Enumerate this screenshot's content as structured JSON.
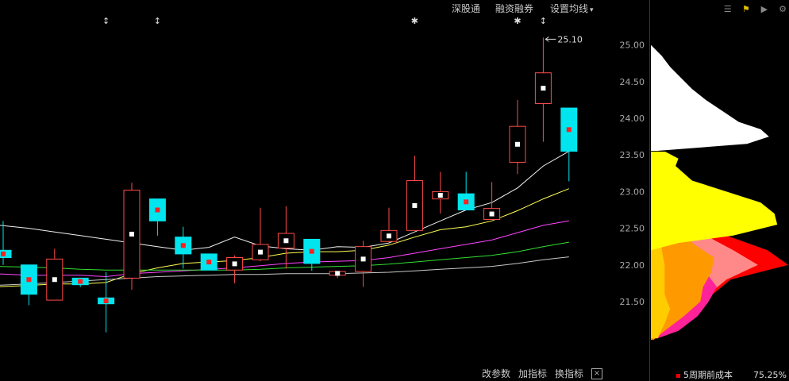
{
  "toolbar": {
    "shen_gu_tong": "深股通",
    "rong_zi_rong_quan": "融资融券",
    "ma_settings": "设置均线",
    "ma_settings_arrow": "▾"
  },
  "bottom": {
    "change_params": "改参数",
    "add_indicator": "加指标",
    "switch_indicator": "换指标",
    "close": "×"
  },
  "chip": {
    "legend_label": "5周期前成本",
    "legend_pct": "75.25%"
  },
  "icons": [
    "list-icon",
    "flag-icon",
    "play-icon",
    "gear-icon"
  ],
  "chart_data": {
    "type": "candlestick",
    "ylim": [
      20.85,
      25.18
    ],
    "yticks": [
      21.5,
      22.0,
      22.5,
      23.0,
      23.5,
      24.0,
      24.5,
      25.0
    ],
    "ytick_labels": [
      "21.50",
      "22.00",
      "22.50",
      "23.00",
      "23.50",
      "24.00",
      "24.50",
      "25.00"
    ],
    "max_label": "25.10",
    "candles": [
      {
        "o": 22.2,
        "c": 22.1,
        "h": 22.6,
        "l": 22.0,
        "mid": "red"
      },
      {
        "o": 22.0,
        "c": 21.6,
        "h": 22.0,
        "l": 21.45,
        "mid": "red"
      },
      {
        "o": 21.52,
        "c": 22.08,
        "h": 22.22,
        "l": 21.52,
        "mid": "white"
      },
      {
        "o": 21.82,
        "c": 21.73,
        "h": 21.82,
        "l": 21.7,
        "mid": "red"
      },
      {
        "o": 21.55,
        "c": 21.47,
        "h": 21.9,
        "l": 21.08,
        "mid": "red"
      },
      {
        "o": 21.82,
        "c": 23.02,
        "h": 23.12,
        "l": 21.66,
        "mid": "white"
      },
      {
        "o": 22.9,
        "c": 22.6,
        "h": 22.9,
        "l": 22.4,
        "mid": "red"
      },
      {
        "o": 22.38,
        "c": 22.15,
        "h": 22.52,
        "l": 21.95,
        "mid": "red"
      },
      {
        "o": 22.15,
        "c": 21.93,
        "h": 22.15,
        "l": 21.93,
        "mid": "red"
      },
      {
        "o": 21.93,
        "c": 22.1,
        "h": 22.13,
        "l": 21.75,
        "mid": "white"
      },
      {
        "o": 22.07,
        "c": 22.28,
        "h": 22.78,
        "l": 22.05,
        "mid": "white"
      },
      {
        "o": 22.23,
        "c": 22.43,
        "h": 22.8,
        "l": 21.95,
        "mid": "white"
      },
      {
        "o": 22.35,
        "c": 22.02,
        "h": 22.35,
        "l": 21.92,
        "mid": "red"
      },
      {
        "o": 21.86,
        "c": 21.91,
        "h": 21.91,
        "l": 21.82,
        "mid": "white"
      },
      {
        "o": 21.91,
        "c": 22.25,
        "h": 22.33,
        "l": 21.7,
        "mid": "white"
      },
      {
        "o": 22.32,
        "c": 22.47,
        "h": 22.78,
        "l": 22.31,
        "mid": "white"
      },
      {
        "o": 22.47,
        "c": 23.15,
        "h": 23.49,
        "l": 22.47,
        "mid": "white"
      },
      {
        "o": 22.9,
        "c": 23.0,
        "h": 23.27,
        "l": 22.7,
        "mid": "white"
      },
      {
        "o": 22.97,
        "c": 22.75,
        "h": 23.27,
        "l": 22.75,
        "mid": "red"
      },
      {
        "o": 22.62,
        "c": 22.77,
        "h": 23.13,
        "l": 22.62,
        "mid": "white"
      },
      {
        "o": 23.4,
        "c": 23.89,
        "h": 24.25,
        "l": 23.24,
        "mid": "white"
      },
      {
        "o": 24.2,
        "c": 24.62,
        "h": 25.1,
        "l": 23.68,
        "mid": "white"
      },
      {
        "o": 24.14,
        "c": 23.55,
        "h": 24.14,
        "l": 23.14,
        "mid": "red"
      }
    ],
    "markers": [
      {
        "index": 4,
        "symbol": "↕"
      },
      {
        "index": 6,
        "symbol": "↕"
      },
      {
        "index": 16,
        "symbol": "✱"
      },
      {
        "index": 20,
        "symbol": "✱"
      },
      {
        "index": 21,
        "symbol": "↕"
      }
    ],
    "ma_lines": [
      {
        "color": "#f0f0f0",
        "values": [
          22.55,
          22.5,
          22.45,
          22.4,
          22.35,
          22.3,
          22.25,
          22.2,
          22.24,
          22.38,
          22.26,
          22.22,
          22.2,
          22.25,
          22.24,
          22.3,
          22.45,
          22.6,
          22.75,
          22.85,
          23.05,
          23.35,
          23.55
        ]
      },
      {
        "color": "#ffff55",
        "values": [
          21.7,
          21.72,
          21.74,
          21.74,
          21.76,
          21.88,
          21.96,
          22.02,
          22.04,
          22.06,
          22.1,
          22.16,
          22.18,
          22.18,
          22.2,
          22.27,
          22.38,
          22.48,
          22.52,
          22.6,
          22.74,
          22.9,
          23.04
        ]
      },
      {
        "color": "#ff44ff",
        "values": [
          21.88,
          21.86,
          21.86,
          21.86,
          21.84,
          21.88,
          21.9,
          21.92,
          21.94,
          21.96,
          21.99,
          22.02,
          22.04,
          22.05,
          22.06,
          22.1,
          22.16,
          22.22,
          22.28,
          22.34,
          22.44,
          22.54,
          22.6
        ]
      },
      {
        "color": "#33dd33",
        "values": [
          21.98,
          21.97,
          21.96,
          21.94,
          21.93,
          21.93,
          21.93,
          21.93,
          21.93,
          21.93,
          21.94,
          21.96,
          21.97,
          21.98,
          21.99,
          22.01,
          22.04,
          22.07,
          22.1,
          22.13,
          22.18,
          22.25,
          22.31
        ]
      },
      {
        "color": "#c8c8c8",
        "values": [
          21.72,
          21.74,
          21.76,
          21.78,
          21.8,
          21.82,
          21.84,
          21.85,
          21.86,
          21.87,
          21.87,
          21.88,
          21.88,
          21.88,
          21.89,
          21.9,
          21.92,
          21.94,
          21.96,
          21.98,
          22.02,
          22.07,
          22.11
        ]
      }
    ],
    "chip_split_price": 23.55,
    "chip_layers": [
      {
        "name": "5周期前成本",
        "color": "#ff0000",
        "profile": [
          [
            23.4,
            0.0
          ],
          [
            23.2,
            0.02
          ],
          [
            23.0,
            0.1
          ],
          [
            22.8,
            0.28
          ],
          [
            22.6,
            0.4
          ],
          [
            22.4,
            0.55
          ],
          [
            22.2,
            0.85
          ],
          [
            22.0,
            1.0
          ],
          [
            21.8,
            0.58
          ],
          [
            21.6,
            0.45
          ],
          [
            21.4,
            0.38
          ],
          [
            21.2,
            0.22
          ],
          [
            21.0,
            0.05
          ]
        ]
      },
      {
        "color": "#ff8888",
        "profile": [
          [
            23.0,
            0.0
          ],
          [
            22.8,
            0.1
          ],
          [
            22.6,
            0.22
          ],
          [
            22.4,
            0.4
          ],
          [
            22.2,
            0.6
          ],
          [
            22.0,
            0.78
          ],
          [
            21.8,
            0.55
          ],
          [
            21.6,
            0.42
          ],
          [
            21.4,
            0.36
          ],
          [
            21.2,
            0.2
          ],
          [
            21.0,
            0.05
          ]
        ]
      },
      {
        "color": "#ff2299",
        "profile": [
          [
            22.7,
            0.0
          ],
          [
            22.5,
            0.06
          ],
          [
            22.3,
            0.18
          ],
          [
            22.1,
            0.3
          ],
          [
            21.9,
            0.4
          ],
          [
            21.7,
            0.48
          ],
          [
            21.5,
            0.42
          ],
          [
            21.3,
            0.34
          ],
          [
            21.1,
            0.2
          ],
          [
            21.0,
            0.05
          ]
        ]
      },
      {
        "color": "#ff9900",
        "profile": [
          [
            23.3,
            0.0
          ],
          [
            23.1,
            0.05
          ],
          [
            22.9,
            0.14
          ],
          [
            22.7,
            0.24
          ],
          [
            22.5,
            0.26
          ],
          [
            22.3,
            0.3
          ],
          [
            22.1,
            0.46
          ],
          [
            21.9,
            0.44
          ],
          [
            21.7,
            0.38
          ],
          [
            21.5,
            0.36
          ],
          [
            21.3,
            0.24
          ],
          [
            21.1,
            0.1
          ],
          [
            20.98,
            0.02
          ]
        ]
      },
      {
        "color": "#ffcc00",
        "profile": [
          [
            25.0,
            0.0
          ],
          [
            24.8,
            0.06
          ],
          [
            24.6,
            0.04
          ],
          [
            24.4,
            0.03
          ],
          [
            24.2,
            0.05
          ],
          [
            24.0,
            0.04
          ],
          [
            23.8,
            0.04
          ],
          [
            23.6,
            0.06
          ],
          [
            23.4,
            0.05
          ],
          [
            23.2,
            0.1
          ],
          [
            23.0,
            0.1
          ],
          [
            22.8,
            0.12
          ],
          [
            22.6,
            0.06
          ],
          [
            22.4,
            0.07
          ],
          [
            22.2,
            0.08
          ],
          [
            22.0,
            0.1
          ],
          [
            21.8,
            0.1
          ],
          [
            21.6,
            0.1
          ],
          [
            21.4,
            0.14
          ],
          [
            21.2,
            0.1
          ],
          [
            21.0,
            0.05
          ]
        ]
      },
      {
        "color": "#ffff00",
        "profile": [
          [
            23.55,
            0.1
          ],
          [
            23.45,
            0.2
          ],
          [
            23.35,
            0.18
          ],
          [
            23.15,
            0.3
          ],
          [
            23.0,
            0.55
          ],
          [
            22.85,
            0.8
          ],
          [
            22.7,
            0.9
          ],
          [
            22.55,
            0.92
          ],
          [
            22.4,
            0.6
          ],
          [
            22.3,
            0.2
          ],
          [
            22.2,
            0.0
          ]
        ]
      },
      {
        "color": "#ffffff",
        "profile": [
          [
            25.0,
            0.0
          ],
          [
            24.85,
            0.08
          ],
          [
            24.7,
            0.14
          ],
          [
            24.55,
            0.22
          ],
          [
            24.4,
            0.3
          ],
          [
            24.25,
            0.4
          ],
          [
            24.1,
            0.52
          ],
          [
            23.95,
            0.64
          ],
          [
            23.85,
            0.8
          ],
          [
            23.75,
            0.86
          ],
          [
            23.65,
            0.7
          ],
          [
            23.55,
            0.0
          ]
        ]
      }
    ]
  }
}
